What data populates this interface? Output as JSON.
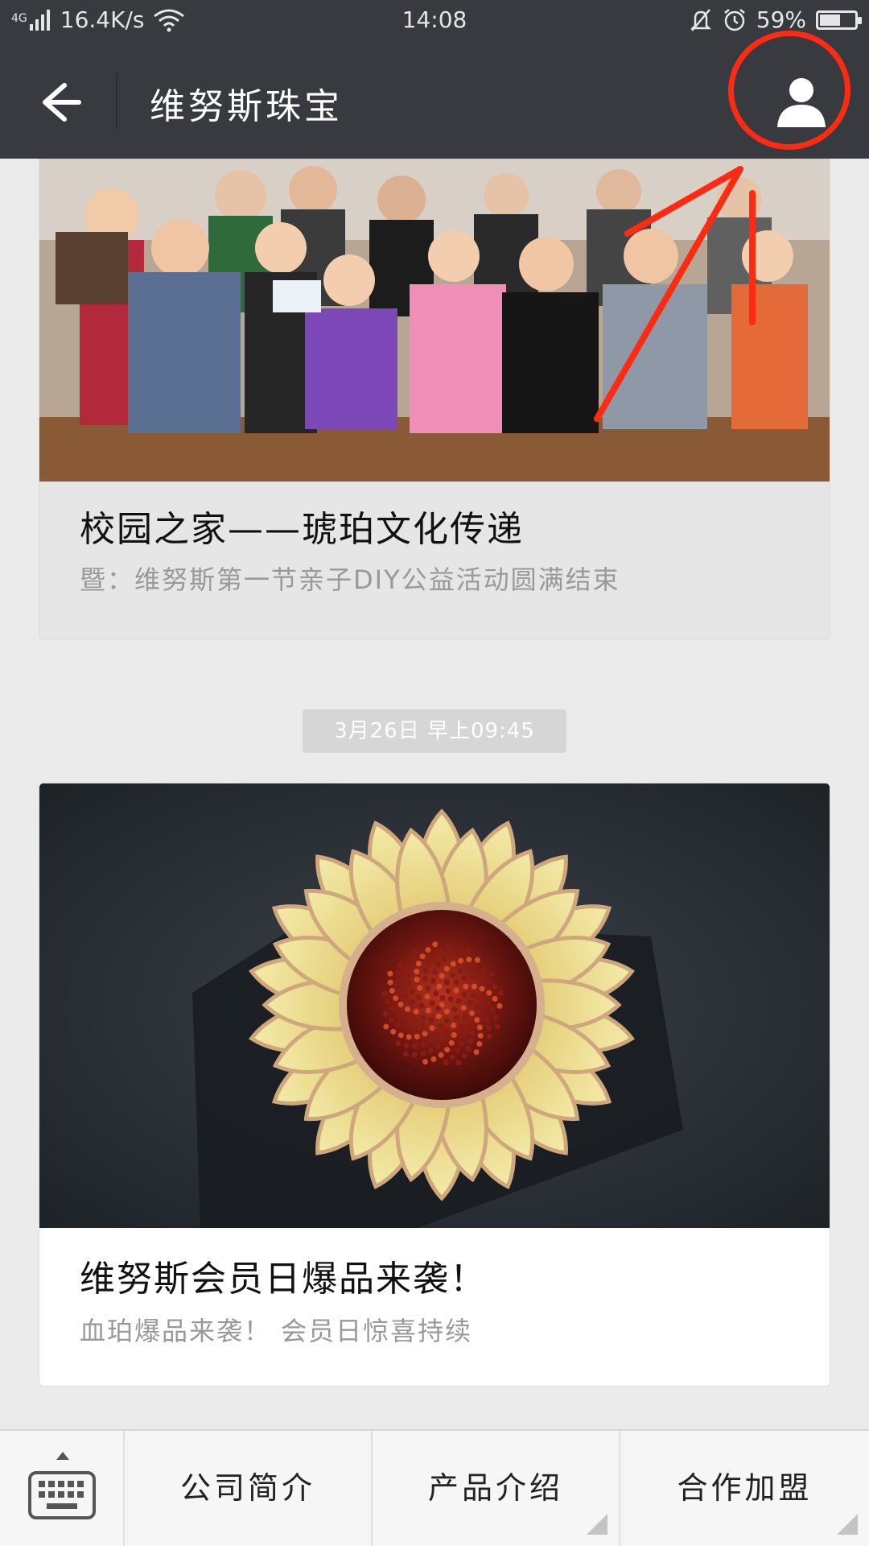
{
  "status_bar": {
    "network": "4G",
    "speed": "16.4K/s",
    "time": "14:08",
    "battery_percent": "59%",
    "battery_level": 0.59
  },
  "header": {
    "title": "维努斯珠宝"
  },
  "feed": [
    {
      "title": "校园之家——琥珀文化传递",
      "subtitle": "暨：维努斯第一节亲子DIY公益活动圆满结束",
      "image": "group-photo-children"
    },
    {
      "timestamp": "3月26日 早上09:45",
      "title": "维努斯会员日爆品来袭！",
      "subtitle": "血珀爆品来袭！ 会员日惊喜持续",
      "image": "sunflower-amber-brooch"
    }
  ],
  "bottom_menu": {
    "items": [
      {
        "label": "公司简介",
        "has_submenu": false
      },
      {
        "label": "产品介绍",
        "has_submenu": true
      },
      {
        "label": "合作加盟",
        "has_submenu": true
      }
    ]
  },
  "colors": {
    "header_bg": "#393a3f",
    "annotation_red": "#ff2a12",
    "page_bg": "#ebebeb"
  },
  "icons": [
    "back-arrow-icon",
    "profile-icon",
    "keyboard-icon",
    "wifi-icon",
    "alarm-icon",
    "bell-mute-icon",
    "battery-icon"
  ]
}
